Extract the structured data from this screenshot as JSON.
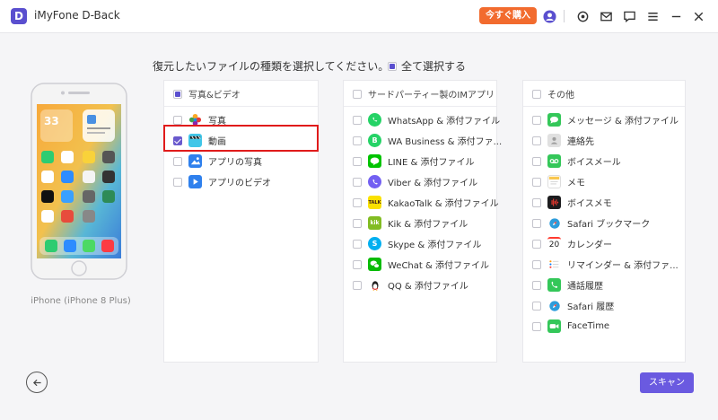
{
  "app": {
    "logo_letter": "D",
    "title": "iMyFone D-Back"
  },
  "titlebar": {
    "buy_label": "今すぐ購入",
    "icons": [
      "user-icon",
      "settings-icon",
      "mail-icon",
      "feedback-icon",
      "menu-icon",
      "minimize-icon",
      "close-icon"
    ]
  },
  "prompt": "復元したいファイルの種類を選択してください。",
  "select_all_label": "全て選択する",
  "device_name": "iPhone (iPhone 8 Plus)",
  "phone": {
    "time": "33",
    "accent": "#f4a640"
  },
  "panels": {
    "photos": {
      "header": "写真&ビデオ",
      "items": [
        "写真",
        "動画",
        "アプリの写真",
        "アプリのビデオ"
      ]
    },
    "third_party": {
      "header": "サードパーティー製のIMアプリ",
      "items": [
        "WhatsApp & 添付ファイル",
        "WA Business & 添付ファ...",
        "LINE & 添付ファイル",
        "Viber & 添付ファイル",
        "KakaoTalk & 添付ファイル",
        "Kik & 添付ファイル",
        "Skype & 添付ファイル",
        "WeChat & 添付ファイル",
        "QQ & 添付ファイル"
      ],
      "icon_text": [
        "",
        "",
        "",
        "",
        "TALK",
        "kik",
        "S",
        "",
        ""
      ]
    },
    "other": {
      "header": "その他",
      "items": [
        "メッセージ & 添付ファイル",
        "連絡先",
        "ボイスメール",
        "メモ",
        "ボイスメモ",
        "Safari ブックマーク",
        "カレンダー",
        "リマインダー & 添付ファ...",
        "通話履歴",
        "Safari 履歴",
        "FaceTime"
      ],
      "calendar_day": "20"
    }
  },
  "scan_label": "スキャン",
  "colors": {
    "accent": "#6a5ae0",
    "buy": "#f26b2e",
    "highlight": "#e01b1b",
    "logo": "#5a4fcf"
  }
}
